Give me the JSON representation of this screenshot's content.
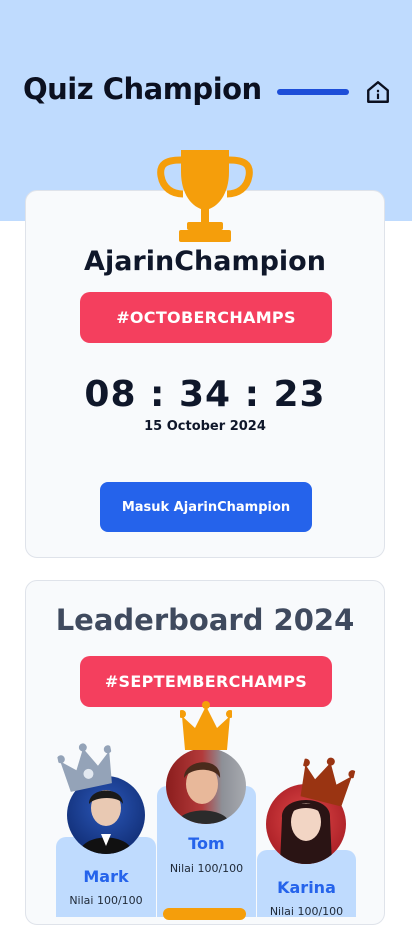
{
  "header": {
    "title": "Quiz Champion",
    "home_icon": "home-icon"
  },
  "champion": {
    "title": "AjarinChampion",
    "tag": "#OCTOBERCHAMPS",
    "countdown": "08 : 34 : 23",
    "date": "15 October 2024",
    "enter_button": "Masuk AjarinChampion",
    "trophy_color": "#f59e0b"
  },
  "leaderboard": {
    "title": "Leaderboard 2024",
    "tag": "#SEPTEMBERCHAMPS",
    "players": [
      {
        "rank": 2,
        "name": "Mark",
        "score": "Nilai 100/100",
        "crown_color": "#94a3b8"
      },
      {
        "rank": 1,
        "name": "Tom",
        "score": "Nilai 100/100",
        "crown_color": "#f59e0b"
      },
      {
        "rank": 3,
        "name": "Karina",
        "score": "Nilai 100/100",
        "crown_color": "#9a3412"
      }
    ]
  },
  "colors": {
    "accent": "#2563eb",
    "tag": "#f43f5e",
    "hero_bg": "#bfdbfe"
  }
}
